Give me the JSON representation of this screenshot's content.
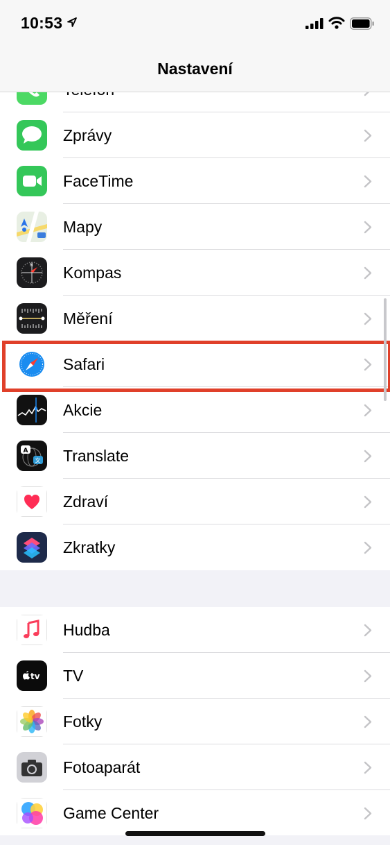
{
  "status": {
    "time": "10:53"
  },
  "nav": {
    "title": "Nastavení"
  },
  "group1": [
    {
      "name": "telefon",
      "label": "Telefon"
    },
    {
      "name": "zpravy",
      "label": "Zprávy"
    },
    {
      "name": "facetime",
      "label": "FaceTime"
    },
    {
      "name": "mapy",
      "label": "Mapy"
    },
    {
      "name": "kompas",
      "label": "Kompas"
    },
    {
      "name": "mereni",
      "label": "Měření"
    },
    {
      "name": "safari",
      "label": "Safari"
    },
    {
      "name": "akcie",
      "label": "Akcie"
    },
    {
      "name": "translate",
      "label": "Translate"
    },
    {
      "name": "zdravi",
      "label": "Zdraví"
    },
    {
      "name": "zkratky",
      "label": "Zkratky"
    }
  ],
  "group2": [
    {
      "name": "hudba",
      "label": "Hudba"
    },
    {
      "name": "tv",
      "label": "TV"
    },
    {
      "name": "fotky",
      "label": "Fotky"
    },
    {
      "name": "fotoaparat",
      "label": "Fotoaparát"
    },
    {
      "name": "game-center",
      "label": "Game Center"
    }
  ],
  "icons": {
    "telefon": "phone-icon",
    "zpravy": "messages-icon",
    "facetime": "facetime-icon",
    "mapy": "maps-icon",
    "kompas": "compass-icon",
    "mereni": "measure-icon",
    "safari": "safari-icon",
    "akcie": "stocks-icon",
    "translate": "translate-icon",
    "zdravi": "health-icon",
    "zkratky": "shortcuts-icon",
    "hudba": "music-icon",
    "tv": "tv-icon",
    "fotky": "photos-icon",
    "fotoaparat": "camera-icon",
    "game-center": "game-center-icon"
  },
  "highlighted": "Safari",
  "colors": {
    "highlight": "#e0402a",
    "chevron": "#c4c4c7",
    "background": "#f2f2f7"
  }
}
